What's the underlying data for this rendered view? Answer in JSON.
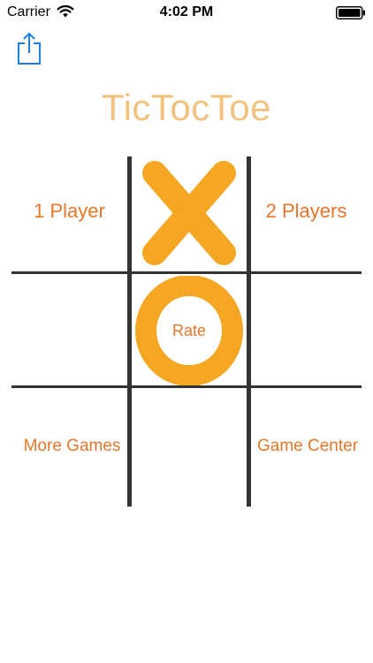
{
  "status_bar": {
    "carrier": "Carrier",
    "time": "4:02 PM",
    "wifi_icon": "wifi-icon",
    "battery_icon": "battery-icon"
  },
  "toolbar": {
    "share_icon": "share-icon"
  },
  "title": "TicTocToe",
  "menu": {
    "one_player": "1 Player",
    "two_players": "2 Players",
    "rate": "Rate",
    "more_games": "More Games",
    "game_center": "Game Center"
  },
  "colors": {
    "title": "#F2C27F",
    "menu_text": "#E8762A",
    "mark": "#F5A623",
    "grid": "#333333",
    "share_icon": "#1A7FE0"
  }
}
